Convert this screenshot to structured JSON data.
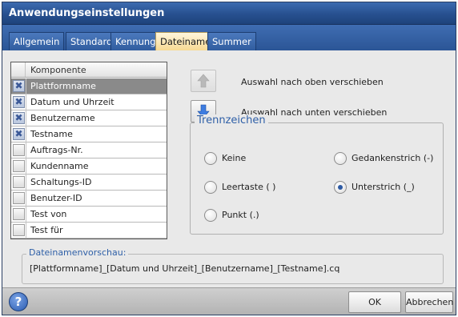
{
  "window": {
    "title": "Anwendungseinstellungen"
  },
  "tabs": [
    {
      "label": "Allgemein",
      "active": false
    },
    {
      "label": "Standard",
      "active": false
    },
    {
      "label": "Kennung",
      "active": false
    },
    {
      "label": "Dateiname",
      "active": true
    },
    {
      "label": "Summer",
      "active": false
    }
  ],
  "component_list": {
    "header": "Komponente",
    "items": [
      {
        "label": "Plattformname",
        "checked": true,
        "selected": true
      },
      {
        "label": "Datum und Uhrzeit",
        "checked": true,
        "selected": false
      },
      {
        "label": "Benutzername",
        "checked": true,
        "selected": false
      },
      {
        "label": "Testname",
        "checked": true,
        "selected": false
      },
      {
        "label": "Auftrags-Nr.",
        "checked": false,
        "selected": false
      },
      {
        "label": "Kundenname",
        "checked": false,
        "selected": false
      },
      {
        "label": "Schaltungs-ID",
        "checked": false,
        "selected": false
      },
      {
        "label": "Benutzer-ID",
        "checked": false,
        "selected": false
      },
      {
        "label": "Test von",
        "checked": false,
        "selected": false
      },
      {
        "label": "Test für",
        "checked": false,
        "selected": false
      }
    ],
    "check_glyph": "✖"
  },
  "move": {
    "up_label": "Auswahl nach oben verschieben",
    "up_enabled": false,
    "down_label": "Auswahl nach unten verschieben",
    "down_enabled": true
  },
  "separator": {
    "title": "Trennzeichen",
    "options": [
      {
        "label": "Keine",
        "checked": false
      },
      {
        "label": "Gedankenstrich (-)",
        "checked": false
      },
      {
        "label": "Leertaste ( )",
        "checked": false
      },
      {
        "label": "Unterstrich (_)",
        "checked": true
      },
      {
        "label": "Punkt (.)",
        "checked": false
      }
    ]
  },
  "preview": {
    "title": "Dateinamenvorschau:",
    "value": "[Plattformname]_[Datum und Uhrzeit]_[Benutzername]_[Testname].cq"
  },
  "footer": {
    "help_glyph": "?",
    "ok_label": "OK",
    "cancel_label": "Abbrechen"
  },
  "colors": {
    "titlebar": "#27508f",
    "active_tab": "#f7d992",
    "group_title": "#2e5fa7",
    "selected_row": "#8a8a8a"
  },
  "icons": {
    "up": "arrow-up-icon",
    "down": "arrow-down-icon",
    "help": "help-icon"
  }
}
